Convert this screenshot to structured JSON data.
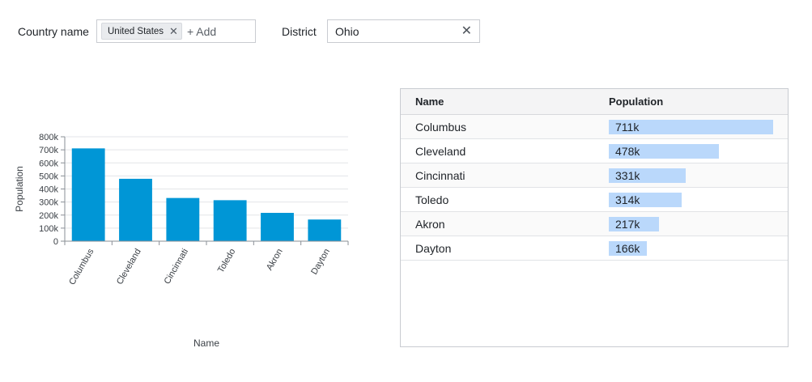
{
  "filters": {
    "country": {
      "label": "Country name",
      "chips": [
        "United States"
      ],
      "add_label": "+ Add"
    },
    "district": {
      "label": "District",
      "value": "Ohio"
    }
  },
  "chart_data": {
    "type": "bar",
    "categories": [
      "Columbus",
      "Cleveland",
      "Cincinnati",
      "Toledo",
      "Akron",
      "Dayton"
    ],
    "values": [
      711000,
      478000,
      331000,
      314000,
      217000,
      166000
    ],
    "xlabel": "Name",
    "ylabel": "Population",
    "ylim": [
      0,
      800000
    ],
    "yticks": [
      0,
      100000,
      200000,
      300000,
      400000,
      500000,
      600000,
      700000,
      800000
    ],
    "ytick_labels": [
      "0",
      "100k",
      "200k",
      "300k",
      "400k",
      "500k",
      "600k",
      "700k",
      "800k"
    ],
    "grid": true,
    "bar_color": "#0096d6"
  },
  "table": {
    "columns": [
      "Name",
      "Population"
    ],
    "rows": [
      {
        "name": "Columbus",
        "population": 711000,
        "population_label": "711k"
      },
      {
        "name": "Cleveland",
        "population": 478000,
        "population_label": "478k"
      },
      {
        "name": "Cincinnati",
        "population": 331000,
        "population_label": "331k"
      },
      {
        "name": "Toledo",
        "population": 314000,
        "population_label": "314k"
      },
      {
        "name": "Akron",
        "population": 217000,
        "population_label": "217k"
      },
      {
        "name": "Dayton",
        "population": 166000,
        "population_label": "166k"
      }
    ],
    "bar_color": "#bad8fb"
  }
}
